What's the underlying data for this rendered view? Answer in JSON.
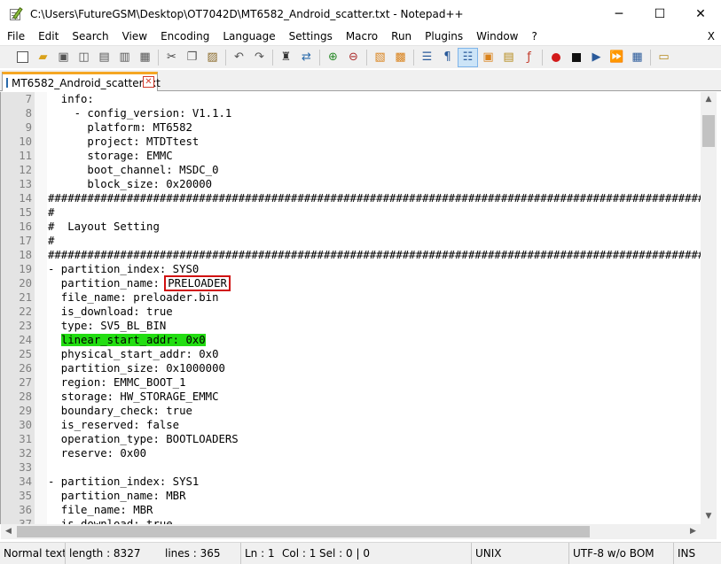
{
  "window": {
    "title": "C:\\Users\\FutureGSM\\Desktop\\OT7042D\\MT6582_Android_scatter.txt - Notepad++",
    "minimize": "─",
    "maximize": "☐",
    "close": "✕"
  },
  "menu": {
    "items": [
      "File",
      "Edit",
      "Search",
      "View",
      "Encoding",
      "Language",
      "Settings",
      "Macro",
      "Run",
      "Plugins",
      "Window",
      "?"
    ],
    "close_doc": "X"
  },
  "toolbar": {
    "icons": [
      "new-file-icon",
      "open-file-icon",
      "save-icon",
      "save-all-icon",
      "close-icon",
      "close-all-icon",
      "print-icon",
      "cut-icon",
      "copy-icon",
      "paste-icon",
      "undo-icon",
      "redo-icon",
      "find-icon",
      "replace-icon",
      "zoom-in-icon",
      "zoom-out-icon",
      "sync-vertical-icon",
      "sync-horizontal-icon",
      "word-wrap-icon",
      "show-all-chars-icon",
      "indent-guide-icon",
      "doc-map-icon",
      "function-list-icon",
      "folder-workspace-icon",
      "record-macro-icon",
      "stop-macro-icon",
      "play-macro-icon",
      "run-macro-multiple-icon",
      "save-macro-icon",
      "spell-check-icon"
    ]
  },
  "tab": {
    "label": "MT6582_Android_scatter.txt",
    "close": "✕"
  },
  "editor": {
    "lines": [
      {
        "n": "7",
        "text": "  info:"
      },
      {
        "n": "8",
        "text": "    - config_version: V1.1.1"
      },
      {
        "n": "9",
        "text": "      platform: MT6582"
      },
      {
        "n": "10",
        "text": "      project: MTDTtest"
      },
      {
        "n": "11",
        "text": "      storage: EMMC"
      },
      {
        "n": "12",
        "text": "      boot_channel: MSDC_0"
      },
      {
        "n": "13",
        "text": "      block_size: 0x20000"
      },
      {
        "n": "14",
        "text": "############################################################################################################"
      },
      {
        "n": "15",
        "text": "#"
      },
      {
        "n": "16",
        "text": "#  Layout Setting"
      },
      {
        "n": "17",
        "text": "#"
      },
      {
        "n": "18",
        "text": "############################################################################################################"
      },
      {
        "n": "19",
        "text": "- partition_index: SYS0"
      },
      {
        "n": "20",
        "text": "  partition_name: ",
        "boxed": "PRELOADER"
      },
      {
        "n": "21",
        "text": "  file_name: preloader.bin"
      },
      {
        "n": "22",
        "text": "  is_download: true"
      },
      {
        "n": "23",
        "text": "  type: SV5_BL_BIN"
      },
      {
        "n": "24",
        "text": "  ",
        "highlight": "linear_start_addr: 0x0"
      },
      {
        "n": "25",
        "text": "  physical_start_addr: 0x0"
      },
      {
        "n": "26",
        "text": "  partition_size: 0x1000000"
      },
      {
        "n": "27",
        "text": "  region: EMMC_BOOT_1"
      },
      {
        "n": "28",
        "text": "  storage: HW_STORAGE_EMMC"
      },
      {
        "n": "29",
        "text": "  boundary_check: true"
      },
      {
        "n": "30",
        "text": "  is_reserved: false"
      },
      {
        "n": "31",
        "text": "  operation_type: BOOTLOADERS"
      },
      {
        "n": "32",
        "text": "  reserve: 0x00"
      },
      {
        "n": "33",
        "text": ""
      },
      {
        "n": "34",
        "text": "- partition_index: SYS1"
      },
      {
        "n": "35",
        "text": "  partition_name: MBR"
      },
      {
        "n": "36",
        "text": "  file_name: MBR"
      },
      {
        "n": "37",
        "text": "  is_download: true"
      }
    ]
  },
  "scroll": {
    "up": "▲",
    "down": "▼",
    "left": "◀",
    "right": "▶"
  },
  "status": {
    "type": "Normal text f",
    "length": "length : 8327",
    "lines": "lines : 365",
    "ln": "Ln : 1",
    "col": "Col : 1",
    "sel": "Sel : 0 | 0",
    "eol": "UNIX",
    "encoding": "UTF-8 w/o BOM",
    "mode": "INS"
  }
}
